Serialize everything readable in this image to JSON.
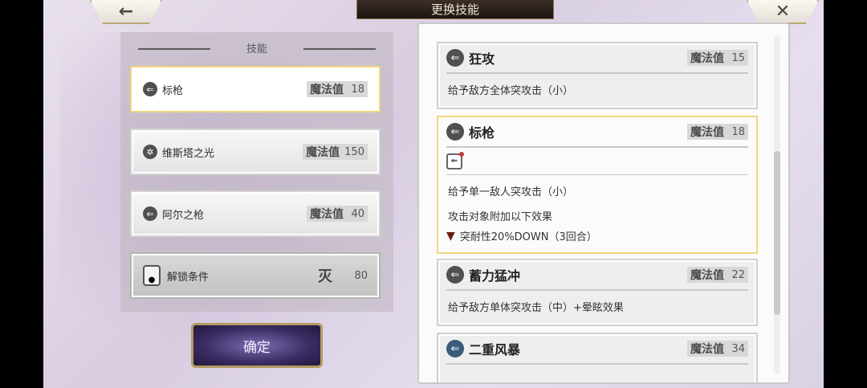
{
  "header": {
    "back_icon": "←",
    "title": "更换技能",
    "close_icon": "✕"
  },
  "left_panel": {
    "title": "技能",
    "skills": [
      {
        "name": "标枪",
        "mp_label": "魔法值",
        "mp": "18",
        "icon": "spear",
        "selected": true
      },
      {
        "name": "维斯塔之光",
        "mp_label": "魔法值",
        "mp": "150",
        "icon": "light"
      },
      {
        "name": "阿尔之枪",
        "mp_label": "魔法值",
        "mp": "40",
        "icon": "spear"
      }
    ],
    "locked": {
      "label": "解锁条件",
      "currency_icon": "灭",
      "cost": "80"
    },
    "confirm_label": "确定"
  },
  "right_panel": {
    "cards": [
      {
        "name": "狂攻",
        "mp_label": "魔法值",
        "mp": "15",
        "desc": "给予敌方全体突攻击（小）"
      },
      {
        "name": "标枪",
        "mp_label": "魔法值",
        "mp": "18",
        "desc": "给予单一敌人突攻击（小）",
        "extra": "攻击对象附加以下效果",
        "effect": "突耐性20%DOWN（3回合）",
        "selected": true
      },
      {
        "name": "蓄力猛冲",
        "mp_label": "魔法值",
        "mp": "22",
        "desc": "给予敌方单体突攻击（中）+晕眩效果"
      },
      {
        "name": "二重风暴",
        "mp_label": "魔法值",
        "mp": "34"
      }
    ]
  }
}
